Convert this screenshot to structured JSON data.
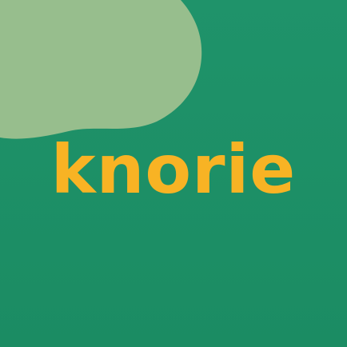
{
  "logo": {
    "text": "knorie"
  },
  "colors": {
    "background": "#1e9168",
    "blob": "#97be8d",
    "logo_text": "#f8b324"
  }
}
